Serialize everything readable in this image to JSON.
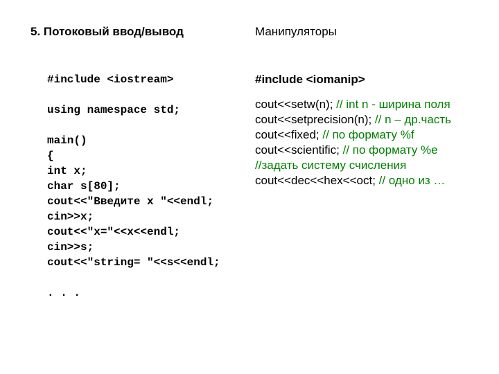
{
  "left": {
    "heading": "5. Потоковый ввод/вывод",
    "code": "#include <iostream>\n\nusing namespace std;\n\nmain()\n{\nint x;\nchar s[80];\ncout<<\"Введите x \"<<endl;\ncin>>x;\ncout<<\"x=\"<<x<<endl;\ncin>>s;\ncout<<\"string= \"<<s<<endl;\n\n. . ."
  },
  "right": {
    "heading": "Манипуляторы",
    "include_line": "#include <iomanip>",
    "lines": [
      {
        "code": "cout<<setw(n); ",
        "comment": "// int n - ширина поля"
      },
      {
        "code": "cout<<setprecision(n); ",
        "comment": "// n – др.часть"
      },
      {
        "code": "cout<<fixed; ",
        "comment": "// по формату %f"
      },
      {
        "code": "cout<<scientific; ",
        "comment": "// по формату %e"
      },
      {
        "code": "",
        "comment": "//задать систему счисления"
      },
      {
        "code": "cout<<dec<<hex<<oct; ",
        "comment": "// одно из …"
      }
    ]
  }
}
